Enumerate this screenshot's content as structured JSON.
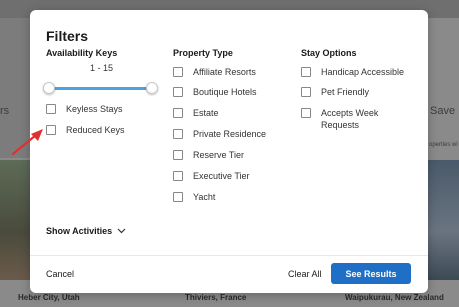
{
  "background": {
    "left_partial_text": "rs",
    "right_partial_text": "Save",
    "right_small_text": "operties wi",
    "cities": [
      "Heber City, Utah",
      "Thiviers, France",
      "Waipukurau, New Zealand"
    ]
  },
  "modal": {
    "title": "Filters",
    "availability": {
      "title": "Availability Keys",
      "range_label": "1 - 15",
      "range_min": 1,
      "range_max": 15,
      "options": [
        {
          "label": "Keyless Stays",
          "checked": false
        },
        {
          "label": "Reduced Keys",
          "checked": false
        }
      ]
    },
    "property_type": {
      "title": "Property Type",
      "options": [
        {
          "label": "Affiliate Resorts",
          "checked": false
        },
        {
          "label": "Boutique Hotels",
          "checked": false
        },
        {
          "label": "Estate",
          "checked": false
        },
        {
          "label": "Private Residence",
          "checked": false
        },
        {
          "label": "Reserve Tier",
          "checked": false
        },
        {
          "label": "Executive Tier",
          "checked": false
        },
        {
          "label": "Yacht",
          "checked": false
        }
      ]
    },
    "stay_options": {
      "title": "Stay Options",
      "options": [
        {
          "label": "Handicap Accessible",
          "checked": false
        },
        {
          "label": "Pet Friendly",
          "checked": false
        },
        {
          "label": "Accepts Week Requests",
          "checked": false
        }
      ]
    },
    "show_activities": "Show Activities",
    "footer": {
      "cancel": "Cancel",
      "clear_all": "Clear All",
      "see_results": "See Results"
    }
  },
  "colors": {
    "accent": "#1f6fc6",
    "slider": "#4aa3df",
    "annotation_arrow": "#e03030"
  }
}
